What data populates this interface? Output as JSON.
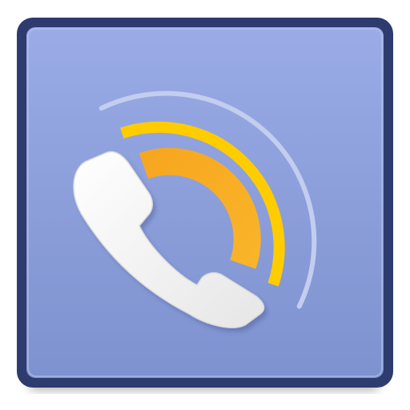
{
  "app_icon": {
    "name": "phone-call-icon",
    "colors": {
      "frame": "#2e3b6e",
      "tile_top": "#9aabe6",
      "tile_bottom": "#7d92cf",
      "handset": "#f2f2f2",
      "wave_inner": "#f6a623",
      "wave_middle": "#ffcc00",
      "wave_outer": "#c3cdee"
    }
  }
}
